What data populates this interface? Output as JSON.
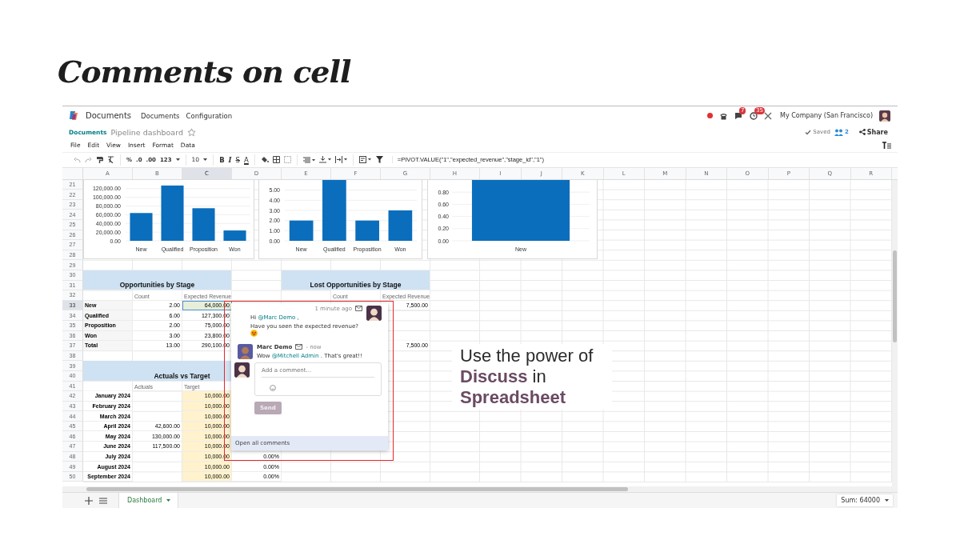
{
  "slide": {
    "title": "Comments on cell",
    "callout": "Use the power of **Discuss** in **Spreadsheet**"
  },
  "navbar": {
    "app": "Documents",
    "menus": [
      "Documents",
      "Configuration"
    ],
    "chat_badge": "7",
    "activity_badge": "35",
    "company": "My Company (San Francisco)"
  },
  "breadcrumb": {
    "parent": "Documents",
    "title": "Pipeline dashboard",
    "starred": false,
    "status": "Saved",
    "users": "2",
    "share": "Share"
  },
  "menu": [
    "File",
    "Edit",
    "View",
    "Insert",
    "Format",
    "Data"
  ],
  "toolbar": {
    "number_formats": [
      "%",
      ".0",
      ".00",
      "123"
    ],
    "font_size": "10",
    "text_styles": [
      "B",
      "I",
      "S",
      "A"
    ],
    "formula": "=PIVOT.VALUE(\"1\",\"expected_revenue\",\"stage_id\",\"1\")"
  },
  "sheet": {
    "columns": [
      {
        "label": "A",
        "selected": false
      },
      {
        "label": "B",
        "selected": false
      },
      {
        "label": "C",
        "selected": true
      },
      {
        "label": "D",
        "selected": false
      },
      {
        "label": "E",
        "selected": false
      },
      {
        "label": "F",
        "selected": false
      },
      {
        "label": "G",
        "selected": false
      },
      {
        "label": "H",
        "selected": false
      },
      {
        "label": "I",
        "selected": false
      },
      {
        "label": "J",
        "selected": false
      },
      {
        "label": "K",
        "selected": false
      },
      {
        "label": "L",
        "selected": false
      },
      {
        "label": "M",
        "selected": false
      },
      {
        "label": "N",
        "selected": false
      },
      {
        "label": "O",
        "selected": false
      },
      {
        "label": "P",
        "selected": false
      },
      {
        "label": "Q",
        "selected": false
      },
      {
        "label": "R",
        "selected": false
      }
    ],
    "row_numbers": [
      {
        "number": "21",
        "selected": false
      },
      {
        "number": "22",
        "selected": false
      },
      {
        "number": "23",
        "selected": false
      },
      {
        "number": "24",
        "selected": false
      },
      {
        "number": "25",
        "selected": false
      },
      {
        "number": "26",
        "selected": false
      },
      {
        "number": "27",
        "selected": false
      },
      {
        "number": "28",
        "selected": false
      },
      {
        "number": "29",
        "selected": false
      },
      {
        "number": "30",
        "selected": false
      },
      {
        "number": "31",
        "selected": false
      },
      {
        "number": "32",
        "selected": false
      },
      {
        "number": "33",
        "selected": true
      },
      {
        "number": "34",
        "selected": false
      },
      {
        "number": "35",
        "selected": false
      },
      {
        "number": "36",
        "selected": false
      },
      {
        "number": "37",
        "selected": false
      },
      {
        "number": "38",
        "selected": false
      },
      {
        "number": "39",
        "selected": false
      },
      {
        "number": "40",
        "selected": false
      },
      {
        "number": "41",
        "selected": false
      },
      {
        "number": "42",
        "selected": false
      },
      {
        "number": "43",
        "selected": false
      },
      {
        "number": "44",
        "selected": false
      },
      {
        "number": "45",
        "selected": false
      },
      {
        "number": "46",
        "selected": false
      },
      {
        "number": "47",
        "selected": false
      },
      {
        "number": "48",
        "selected": false
      },
      {
        "number": "49",
        "selected": false
      },
      {
        "number": "50",
        "selected": false
      }
    ],
    "charts": [
      {
        "chart_data": {
          "type": "bar",
          "grid": true,
          "categories": [
            "New",
            "Qualified",
            "Proposition",
            "Won"
          ],
          "series": [
            {
              "color": "#0a6ebd",
              "values": [
                64000,
                127300,
                75000,
                23800
              ]
            }
          ],
          "ylim": [
            0,
            140000
          ],
          "yticks": [
            {
              "value": 0,
              "label": "0.00"
            },
            {
              "value": 20000,
              "label": "20,000.00"
            },
            {
              "value": 40000,
              "label": "40,000.00"
            },
            {
              "value": 60000,
              "label": "60,000.00"
            },
            {
              "value": 80000,
              "label": "80,000.00"
            },
            {
              "value": 100000,
              "label": "100,000.00"
            },
            {
              "value": 120000,
              "label": "120,000.00"
            }
          ]
        }
      },
      {
        "chart_data": {
          "type": "bar",
          "grid": true,
          "categories": [
            "New",
            "Qualified",
            "Proposition",
            "Won"
          ],
          "series": [
            {
              "color": "#0a6ebd",
              "values": [
                2,
                6,
                2,
                3
              ]
            }
          ],
          "ylim": [
            0,
            6
          ],
          "yticks": [
            {
              "value": 0,
              "label": "0.00"
            },
            {
              "value": 1,
              "label": "1.00"
            },
            {
              "value": 2,
              "label": "2.00"
            },
            {
              "value": 3,
              "label": "3.00"
            },
            {
              "value": 4,
              "label": "4.00"
            },
            {
              "value": 5,
              "label": "5.00"
            }
          ]
        }
      },
      {
        "chart_data": {
          "type": "bar",
          "grid": true,
          "categories": [
            "New"
          ],
          "series": [
            {
              "color": "#0a6ebd",
              "values": [
                1
              ]
            }
          ],
          "ylim": [
            0,
            1
          ],
          "yticks": [
            {
              "value": 0,
              "label": "0.00"
            },
            {
              "value": 0.2,
              "label": "0.20"
            },
            {
              "value": 0.4,
              "label": "0.40"
            },
            {
              "value": 0.6,
              "label": "0.60"
            },
            {
              "value": 0.8,
              "label": "0.80"
            }
          ]
        }
      }
    ],
    "tables": [
      {
        "kind": "stage",
        "title": "Opportunities by Stage",
        "headers": [
          "Count",
          "Expected Revenue"
        ],
        "rows": [
          {
            "label": "New",
            "count": "2.00",
            "revenue": "64,000.00"
          },
          {
            "label": "Qualified",
            "count": "6.00",
            "revenue": "127,300.00"
          },
          {
            "label": "Proposition",
            "count": "2.00",
            "revenue": "75,000.00"
          },
          {
            "label": "Won",
            "count": "3.00",
            "revenue": "23,800.00"
          },
          {
            "label": "Total",
            "count": "13.00",
            "revenue": "290,100.00"
          }
        ]
      },
      {
        "kind": "stage",
        "title": "Lost Opportunities by Stage",
        "headers": [
          "Count",
          "Expected Revenue"
        ],
        "rows": [
          {
            "revenue": "7,500.00"
          },
          {},
          {},
          {},
          {
            "revenue": "7,500.00"
          }
        ]
      },
      {
        "kind": "target",
        "title": "Actuals vs Target",
        "headers": [
          "Actuals",
          "Target"
        ],
        "rows": [
          {
            "label": "January 2024",
            "target": "10,000.00"
          },
          {
            "label": "February 2024",
            "target": "10,000.00"
          },
          {
            "label": "March 2024",
            "target": "10,000.00"
          },
          {
            "label": "April 2024",
            "actual": "42,600.00",
            "target": "10,000.00"
          },
          {
            "label": "May 2024",
            "actual": "130,000.00",
            "target": "10,000.00"
          },
          {
            "label": "June 2024",
            "actual": "117,500.00",
            "target": "10,000.00"
          },
          {
            "label": "July 2024",
            "target": "10,000.00",
            "ratio": "0.00%"
          },
          {
            "label": "August 2024",
            "target": "10,000.00",
            "ratio": "0.00%"
          },
          {
            "label": "September 2024",
            "target": "10,000.00",
            "ratio": "0.00%"
          }
        ]
      }
    ]
  },
  "comment_thread": {
    "messages": [
      {
        "kind": "own",
        "time": "1 minute ago",
        "before": "Hi",
        "mention": "@Marc Demo",
        "after": ",",
        "line2": "Have you seen the expected revenue?"
      },
      {
        "kind": "reply",
        "author": "Marc Demo",
        "time": "- now",
        "before": "Wow",
        "mention": "@Mitchell Admin",
        "after": ". That's great!!"
      }
    ],
    "composer": {
      "placeholder": "Add a comment...",
      "send": "Send",
      "send_disabled": true
    },
    "footer": "Open all comments"
  },
  "sheet_tabs": [
    {
      "label": "Dashboard",
      "selected": true
    }
  ],
  "status": "Sum: 64000"
}
